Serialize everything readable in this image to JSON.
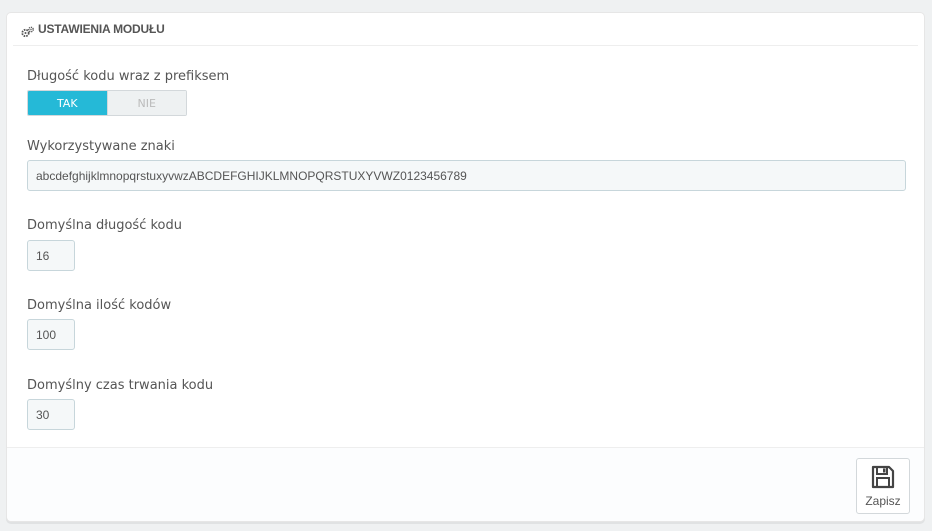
{
  "panel": {
    "title": "USTAWIENIA MODUŁU",
    "title_icon": "cogs-icon"
  },
  "fields": {
    "prefix_length": {
      "label": "Długość kodu wraz z prefiksem",
      "on_label": "TAK",
      "off_label": "NIE",
      "selected": "TAK"
    },
    "characters": {
      "label": "Wykorzystywane znaki",
      "value": "abcdefghijklmnopqrstuxyvwzABCDEFGHIJKLMNOPQRSTUXYVWZ0123456789"
    },
    "default_length": {
      "label": "Domyślna długość kodu",
      "value": "16"
    },
    "default_count": {
      "label": "Domyślna ilość kodów",
      "value": "100"
    },
    "default_duration": {
      "label": "Domyślny czas trwania kodu",
      "value": "30"
    }
  },
  "footer": {
    "save_label": "Zapisz",
    "save_icon": "save-icon"
  },
  "colors": {
    "accent": "#25b9d7",
    "background": "#eff1f2",
    "input_bg": "#f5f8f9"
  }
}
